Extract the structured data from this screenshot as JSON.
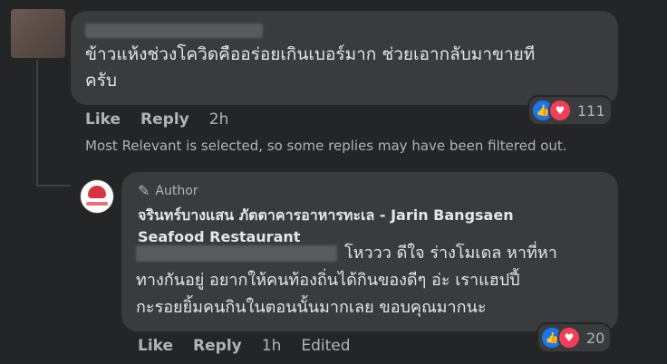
{
  "comment": {
    "text_line1": "ข้าวแห้งช่วงโควิดคืออร่อยเกินเบอร์มาก ช่วยเอากลับมาขายที",
    "text_line2": "ครับ",
    "actions": {
      "like": "Like",
      "reply": "Reply",
      "time": "2h"
    },
    "reactions": {
      "count": "111",
      "icons": [
        "like-icon",
        "love-icon"
      ]
    }
  },
  "filter_note": "Most Relevant is selected, so some replies may have been filtered out.",
  "reply": {
    "author_badge": "Author",
    "author_icon": "pencil-icon",
    "page_name_line1": "จรินทร์บางแสน ภัตตาคารอาหารทะเล - Jarin Bangsaen",
    "page_name_line2": "Seafood Restaurant",
    "text_line1": "โหววว ดีใจ ร่างโมเดล หาที่หา",
    "text_line2": "ทางกันอยู่ อยากให้คนท้องถิ่นได้กินของดีๆ อ่ะ เราแฮปปี้",
    "text_line3": "กะรอยยิ้มคนกินในตอนนั้นมากเลย ขอบคุณมากนะ",
    "actions": {
      "like": "Like",
      "reply": "Reply",
      "time": "1h",
      "edited": "Edited"
    },
    "reactions": {
      "count": "20",
      "icons": [
        "like-icon",
        "love-icon"
      ]
    }
  },
  "colors": {
    "background": "#242526",
    "bubble": "#3a3b3c",
    "like": "#1877f2",
    "love": "#f33e58",
    "secondary_text": "#b0b3b8"
  }
}
